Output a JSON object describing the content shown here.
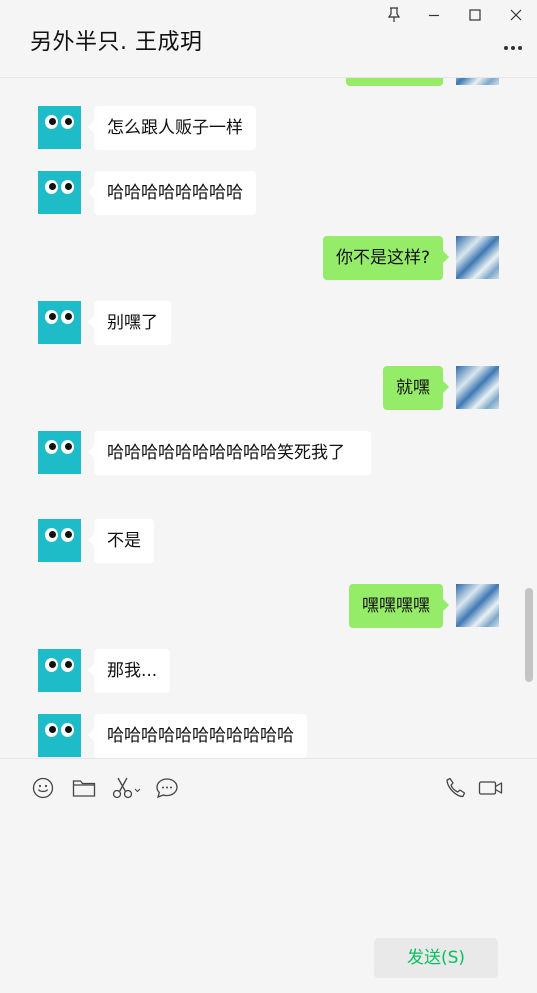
{
  "window": {
    "title": "另外半只. 王成玥"
  },
  "messages": [
    {
      "side": "right",
      "text": ""
    },
    {
      "side": "left",
      "text": "怎么跟人贩子一样"
    },
    {
      "side": "left",
      "text": "哈哈哈哈哈哈哈哈"
    },
    {
      "side": "right",
      "text": "你不是这样?"
    },
    {
      "side": "left",
      "text": "别嘿了"
    },
    {
      "side": "right",
      "text": "就嘿"
    },
    {
      "side": "left",
      "text": "哈哈哈哈哈哈哈哈哈哈笑死我了"
    },
    {
      "side": "left",
      "text": "不是"
    },
    {
      "side": "right",
      "text": "嘿嘿嘿嘿"
    },
    {
      "side": "left",
      "text": "那我..."
    },
    {
      "side": "left",
      "text": "哈哈哈哈哈哈哈哈哈哈哈"
    }
  ],
  "toolbar": {
    "icons": [
      "emoji-icon",
      "folder-icon",
      "scissors-icon",
      "chat-history-icon",
      "phone-icon",
      "video-icon"
    ]
  },
  "input": {
    "value": ""
  },
  "send_button": {
    "label": "发送(S)"
  },
  "colors": {
    "background": "#f5f5f5",
    "self_bubble": "#95ec69",
    "other_bubble": "#ffffff",
    "avatar_other": "#1ebcc9",
    "send_text": "#07c160"
  }
}
